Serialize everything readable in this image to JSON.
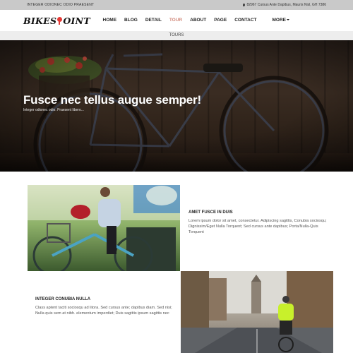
{
  "topbar": {
    "left_text": "INTEGER ODIONEC ODIO PRAESENT",
    "address": "82967 Cursus Ante Dapibus, Mauris Nisl, GH 7386"
  },
  "navbar": {
    "logo_part1": "BIKES",
    "logo_part2": "OINT",
    "menu": [
      {
        "label": "HOME",
        "active": false
      },
      {
        "label": "BLOG",
        "active": false
      },
      {
        "label": "DETAIL",
        "active": false
      },
      {
        "label": "TOUR",
        "active": true
      },
      {
        "label": "ABOUT",
        "active": false
      },
      {
        "label": "PAGE",
        "active": false
      },
      {
        "label": "CONTACT",
        "active": false
      },
      {
        "label": "MORE",
        "active": false
      }
    ]
  },
  "subbar": {
    "label": "TOURS"
  },
  "hero": {
    "title": "Fusce nec tellus augue semper!",
    "subtitle": "Integer odionec odio. Praesent libero..."
  },
  "sections": [
    {
      "heading": "AMET FUSCE IN DUIS",
      "body": "Lorem ipsum dolor sit amet, consectetur. Adipiscing sagittis, Conubia sociosqu; Dignissim/Eget Nulla Torquent; Sed cursus ante dapibus; Porta/Nulla-Quis Torquent"
    },
    {
      "heading": "INTEGER CONUBIA NULLA",
      "body": "Class aptent taciti sociosqu ad litora. Sed cursus ante; dapibus diam. Sed nisi; Nulla quis sem at nibh. elementum imperdiet; Duis sagittis ipsum sagittis nec"
    }
  ],
  "colors": {
    "accent": "#e53935",
    "active_menu": "#d28a7c",
    "topbar_bg": "#c9c9c9"
  }
}
